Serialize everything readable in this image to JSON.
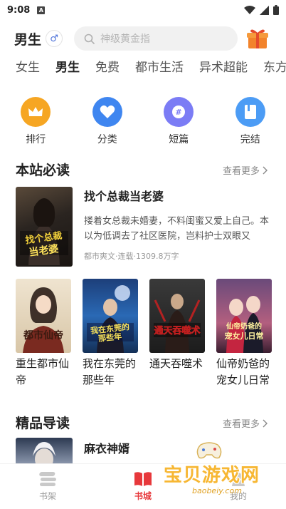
{
  "status_bar": {
    "time": "9:08",
    "a_icon_text": "A"
  },
  "header": {
    "gender_label": "男生",
    "gender_icon": "male-icon",
    "search_placeholder": "神级黄金指",
    "gift_icon": "gift-icon"
  },
  "tabs": [
    {
      "label": "女生",
      "active": false
    },
    {
      "label": "男生",
      "active": true
    },
    {
      "label": "免费",
      "active": false
    },
    {
      "label": "都市生活",
      "active": false
    },
    {
      "label": "异术超能",
      "active": false
    },
    {
      "label": "东方",
      "active": false
    }
  ],
  "categories": [
    {
      "label": "排行",
      "icon": "crown-icon",
      "color": "#f6a623"
    },
    {
      "label": "分类",
      "icon": "heart-icon",
      "color": "#3f86f0"
    },
    {
      "label": "短篇",
      "icon": "hash-icon",
      "color": "#7b7cf5"
    },
    {
      "label": "完结",
      "icon": "book-icon",
      "color": "#4c9cf5"
    }
  ],
  "section1": {
    "title": "本站必读",
    "more": "查看更多",
    "featured": {
      "title": "找个总裁当老婆",
      "desc": "搂着女总裁未婚妻，不料闺蜜又爱上自己。本以为低调去了社区医院，岂料护士双眼又",
      "meta": "都市爽文·连载·1309.8万字",
      "cover_text": "找个总裁当老婆"
    },
    "grid": [
      {
        "title": "重生都市仙帝",
        "cover_text": "重生都市仙帝"
      },
      {
        "title": "我在东莞的那些年",
        "cover_text": "我在东莞的那些年"
      },
      {
        "title": "通天吞噬术",
        "cover_text": "通天吞噬术"
      },
      {
        "title": "仙帝奶爸的宠女儿日常",
        "cover_text": "仙帝奶爸的宠女儿日常"
      }
    ]
  },
  "section2": {
    "title": "精品导读",
    "more": "查看更多",
    "featured": {
      "title": "麻衣神婿"
    }
  },
  "bottom_nav": [
    {
      "label": "书架",
      "icon": "bookshelf-icon",
      "active": false
    },
    {
      "label": "书城",
      "icon": "bookstore-icon",
      "active": true
    },
    {
      "label": "我的",
      "icon": "profile-icon",
      "active": false
    }
  ],
  "watermark": {
    "text": "宝贝游戏网",
    "sub": "baobeiy.com"
  },
  "colors": {
    "accent": "#e7383b"
  }
}
